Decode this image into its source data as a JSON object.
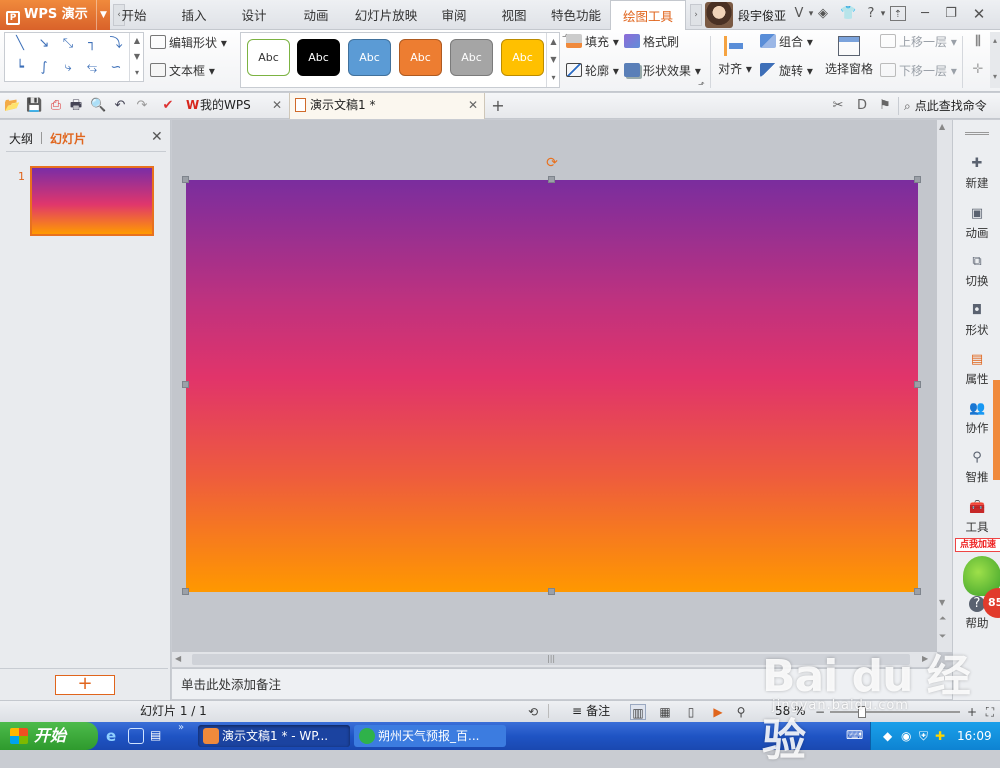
{
  "app": {
    "name": "WPS 演示",
    "accent_color": "#e0651d"
  },
  "ribbon_tabs": [
    {
      "label": "开始",
      "display": "开始"
    },
    {
      "label": "插入"
    },
    {
      "label": "设计"
    },
    {
      "label": "动画"
    },
    {
      "label": "幻灯片放映"
    },
    {
      "label": "审阅"
    },
    {
      "label": "视图"
    },
    {
      "label": "特色功能"
    },
    {
      "label": "绘图工具",
      "active": true
    }
  ],
  "user": {
    "name": "段宇俊亚"
  },
  "ribbon": {
    "edit_shape": "编辑形状",
    "text_box": "文本框",
    "style_samples": [
      {
        "label": "Abc",
        "bg": "#ffffff",
        "border": "#7cb342",
        "color": "#333333"
      },
      {
        "label": "Abc",
        "bg": "#000000",
        "border": "#000000",
        "color": "#ffffff"
      },
      {
        "label": "Abc",
        "bg": "#5b9bd5",
        "border": "#41719c",
        "color": "#ffffff"
      },
      {
        "label": "Abc",
        "bg": "#ed7d31",
        "border": "#ae5a21",
        "color": "#ffffff"
      },
      {
        "label": "Abc",
        "bg": "#a5a5a5",
        "border": "#7b7b7b",
        "color": "#ffffff"
      },
      {
        "label": "Abc",
        "bg": "#ffc000",
        "border": "#bc8c00",
        "color": "#ffffff"
      }
    ],
    "fill": "填充",
    "format_painter": "格式刷",
    "outline": "轮廓",
    "shape_effects": "形状效果",
    "align": "对齐",
    "group": "组合",
    "rotate": "旋转",
    "selection_pane": "选择窗格",
    "bring_forward": "上移一层",
    "send_backward": "下移一层"
  },
  "quickbar": {
    "tabs": [
      {
        "label": "我的WPS"
      },
      {
        "label": "演示文稿1 *"
      }
    ],
    "search_label": "点此查找命令"
  },
  "left_panel": {
    "tab_outline": "大纲",
    "tab_slides": "幻灯片",
    "slide_number": "1",
    "add_slide": "+"
  },
  "canvas": {
    "notes_placeholder": "单击此处添加备注",
    "slide_gradient": [
      "#7a2d9e",
      "#e1346a",
      "#ff9800"
    ]
  },
  "right_sidebar": [
    {
      "label": "新建",
      "icon": "new-icon"
    },
    {
      "label": "动画",
      "icon": "animation-icon"
    },
    {
      "label": "切换",
      "icon": "transition-icon"
    },
    {
      "label": "形状",
      "icon": "shape-icon"
    },
    {
      "label": "属性",
      "icon": "property-icon"
    },
    {
      "label": "协作",
      "icon": "collaborate-icon"
    },
    {
      "label": "智推",
      "icon": "smart-push-icon"
    },
    {
      "label": "工具",
      "icon": "tools-icon"
    },
    {
      "label": "帮助",
      "icon": "help-icon"
    }
  ],
  "promo": {
    "badge": "点我加速",
    "number": "85"
  },
  "statusbar": {
    "slide_info": "幻灯片 1 / 1",
    "notes": "备注",
    "zoom": "58 %"
  },
  "taskbar": {
    "start": "开始",
    "tasks": [
      {
        "label": "演示文稿1 * - WP..."
      },
      {
        "label": "朔州天气预报_百..."
      }
    ],
    "clock": "16:09"
  },
  "watermark": {
    "main": "Bai du 经验",
    "url": "jingyan.baidu.com"
  }
}
